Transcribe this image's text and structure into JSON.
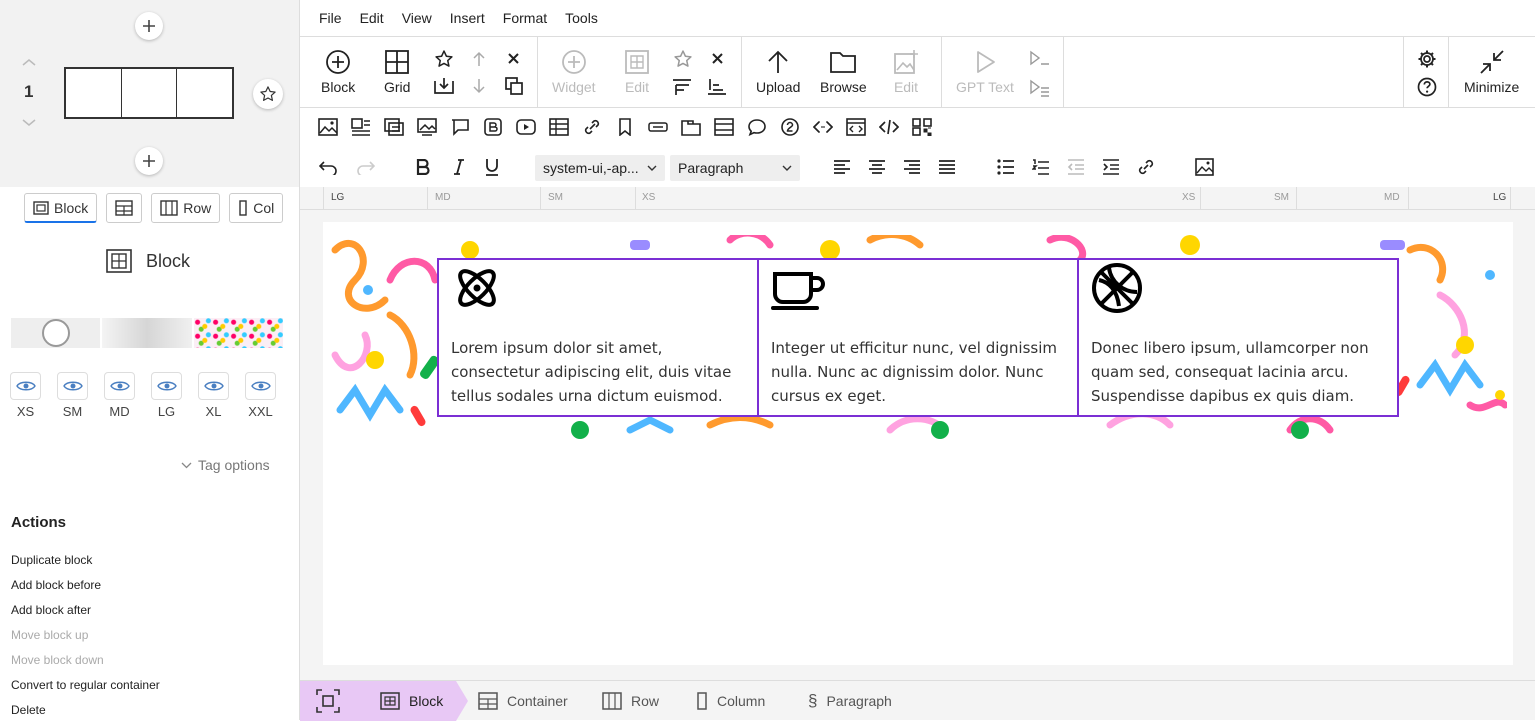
{
  "preview": {
    "block_number": "1"
  },
  "tabs": [
    {
      "label": "Block"
    },
    {
      "label": ""
    },
    {
      "label": "Row"
    },
    {
      "label": "Col"
    }
  ],
  "panel": {
    "title": "Block",
    "tag_options": "Tag options"
  },
  "breakpoints": [
    "XS",
    "SM",
    "MD",
    "LG",
    "XL",
    "XXL"
  ],
  "actions": {
    "heading": "Actions",
    "items": [
      "Duplicate block",
      "Add block before",
      "Add block after",
      "Move block up",
      "Move block down",
      "Convert to regular container",
      "Delete"
    ]
  },
  "menu": [
    "File",
    "Edit",
    "View",
    "Insert",
    "Format",
    "Tools"
  ],
  "toolbar": {
    "block": "Block",
    "grid": "Grid",
    "widget": "Widget",
    "edit": "Edit",
    "upload": "Upload",
    "browse": "Browse",
    "edit2": "Edit",
    "gpt": "GPT Text",
    "minimize": "Minimize"
  },
  "format": {
    "font": "system-ui,-ap...",
    "paragraph": "Paragraph"
  },
  "ruler": {
    "left": [
      "LG",
      "MD",
      "SM",
      "XS"
    ],
    "right": [
      "XS",
      "SM",
      "MD",
      "LG"
    ]
  },
  "content": {
    "columns": [
      {
        "icon": "atom-icon",
        "text": "Lorem ipsum dolor sit amet, consectetur adipiscing elit, duis vitae tellus sodales urna dictum euismod."
      },
      {
        "icon": "coffee-cup-icon",
        "text": "Integer ut efficitur nunc, vel dignissim nulla. Nunc ac dignissim dolor. Nunc cursus ex eget."
      },
      {
        "icon": "basketball-icon",
        "text": "Donec libero ipsum, ullamcorper non quam sed, consequat lacinia arcu. Suspendisse dapibus ex quis diam."
      }
    ]
  },
  "statusbar": [
    "Block",
    "Container",
    "Row",
    "Column",
    "Paragraph"
  ],
  "colors": {
    "accent": "#7b2fd4",
    "crumb_active": "#e8c8f5",
    "tab_active": "#1a73e8"
  }
}
